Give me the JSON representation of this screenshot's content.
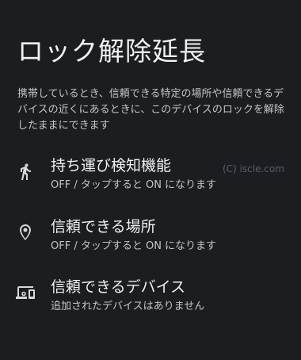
{
  "page": {
    "title": "ロック解除延長",
    "description": "携帯しているとき、信頼できる特定の場所や信頼できるデバイスの近くにあるときに、このデバイスのロックを解除したままにできます"
  },
  "items": [
    {
      "icon": "walking-person-icon",
      "title": "持ち運び検知機能",
      "summary": "OFF / タップすると ON になります"
    },
    {
      "icon": "location-pin-icon",
      "title": "信頼できる場所",
      "summary": "OFF / タップすると ON になります"
    },
    {
      "icon": "devices-icon",
      "title": "信頼できるデバイス",
      "summary": "追加されたデバイスはありません"
    }
  ],
  "watermark": "(C) iscle.com",
  "colors": {
    "background": "#1b1d21",
    "text_primary": "#f0f0f0",
    "text_secondary": "#c5c5c5",
    "icon": "#d8d8d8"
  }
}
